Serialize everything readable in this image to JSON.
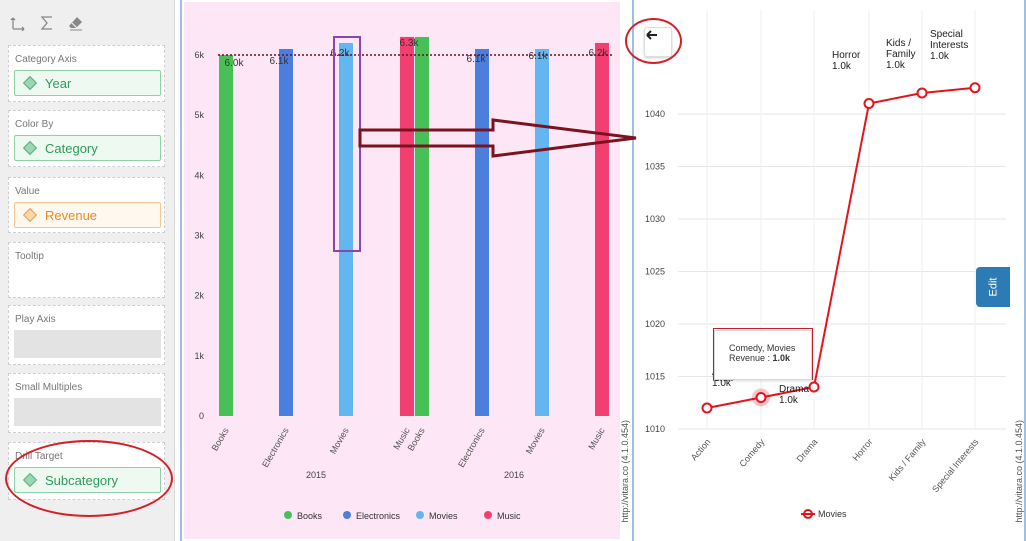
{
  "toolbar": {
    "icons": [
      "swap-axes-icon",
      "sigma-icon",
      "eraser-icon"
    ]
  },
  "panes": {
    "category_axis": {
      "title": "Category Axis",
      "value": "Year"
    },
    "color_by": {
      "title": "Color By",
      "value": "Category"
    },
    "value": {
      "title": "Value",
      "value": "Revenue"
    },
    "tooltip": {
      "title": "Tooltip"
    },
    "play_axis": {
      "title": "Play Axis"
    },
    "small_multiples": {
      "title": "Small Multiples"
    },
    "drill_target": {
      "title": "Drill Target",
      "value": "Subcategory"
    }
  },
  "colors": {
    "books": "#47c057",
    "electronics": "#4a7fdf",
    "movies": "#64b6f0",
    "music": "#f1406f",
    "drill_line": "#e3141b",
    "annotation": "#d51f26"
  },
  "watermark": "http://vitara.co  (4.1.0.454)",
  "chart_data": [
    {
      "type": "bar",
      "categories": [
        "Books",
        "Electronics",
        "Movies",
        "Music",
        "Books",
        "Electronics",
        "Movies",
        "Music"
      ],
      "groups": [
        "2015",
        "2016"
      ],
      "series": [
        {
          "name": "Books",
          "values": [
            6000,
            null,
            null,
            null,
            6300,
            null,
            null,
            null
          ]
        },
        {
          "name": "Electronics",
          "values": [
            null,
            6100,
            null,
            null,
            null,
            6100,
            null,
            null
          ]
        },
        {
          "name": "Movies",
          "values": [
            null,
            null,
            6200,
            null,
            null,
            null,
            6100,
            null
          ]
        },
        {
          "name": "Music",
          "values": [
            null,
            null,
            null,
            6300,
            null,
            null,
            null,
            6200
          ]
        }
      ],
      "data_labels": [
        "6.0k",
        "6.1k",
        "6.2k",
        "6.3k",
        "6.1k",
        "6.1k",
        "6.2k"
      ],
      "yticks": [
        "0",
        "1k",
        "2k",
        "3k",
        "4k",
        "5k",
        "6k"
      ],
      "ylim": [
        0,
        6800
      ],
      "reference_line": 6000,
      "legend": [
        "Books",
        "Electronics",
        "Movies",
        "Music"
      ],
      "legend_position": "bottom"
    },
    {
      "type": "line",
      "x": [
        "Action",
        "Comedy",
        "Drama",
        "Horror",
        "Kids / Family",
        "Special Interests"
      ],
      "values": [
        1012,
        1013,
        1014,
        1041,
        1042,
        1042.5
      ],
      "point_labels": [
        {
          "name": "Action",
          "value": "1.0k"
        },
        {
          "name": "Comedy",
          "value": "1.0k"
        },
        {
          "name": "Drama",
          "value": "1.0k"
        },
        {
          "name": "Horror",
          "value": "1.0k"
        },
        {
          "name": "Kids / Family",
          "value": "1.0k"
        },
        {
          "name": "Special Interests",
          "value": "1.0k"
        }
      ],
      "yticks": [
        "1010",
        "1015",
        "1020",
        "1025",
        "1030",
        "1035",
        "1040"
      ],
      "ylim": [
        1010,
        1044
      ],
      "legend": [
        "Movies"
      ],
      "legend_position": "bottom",
      "grid": true,
      "tooltip": {
        "title": "Comedy, Movies",
        "label": "Revenue :",
        "value": "1.0k"
      }
    }
  ],
  "edit_label": "Edit"
}
